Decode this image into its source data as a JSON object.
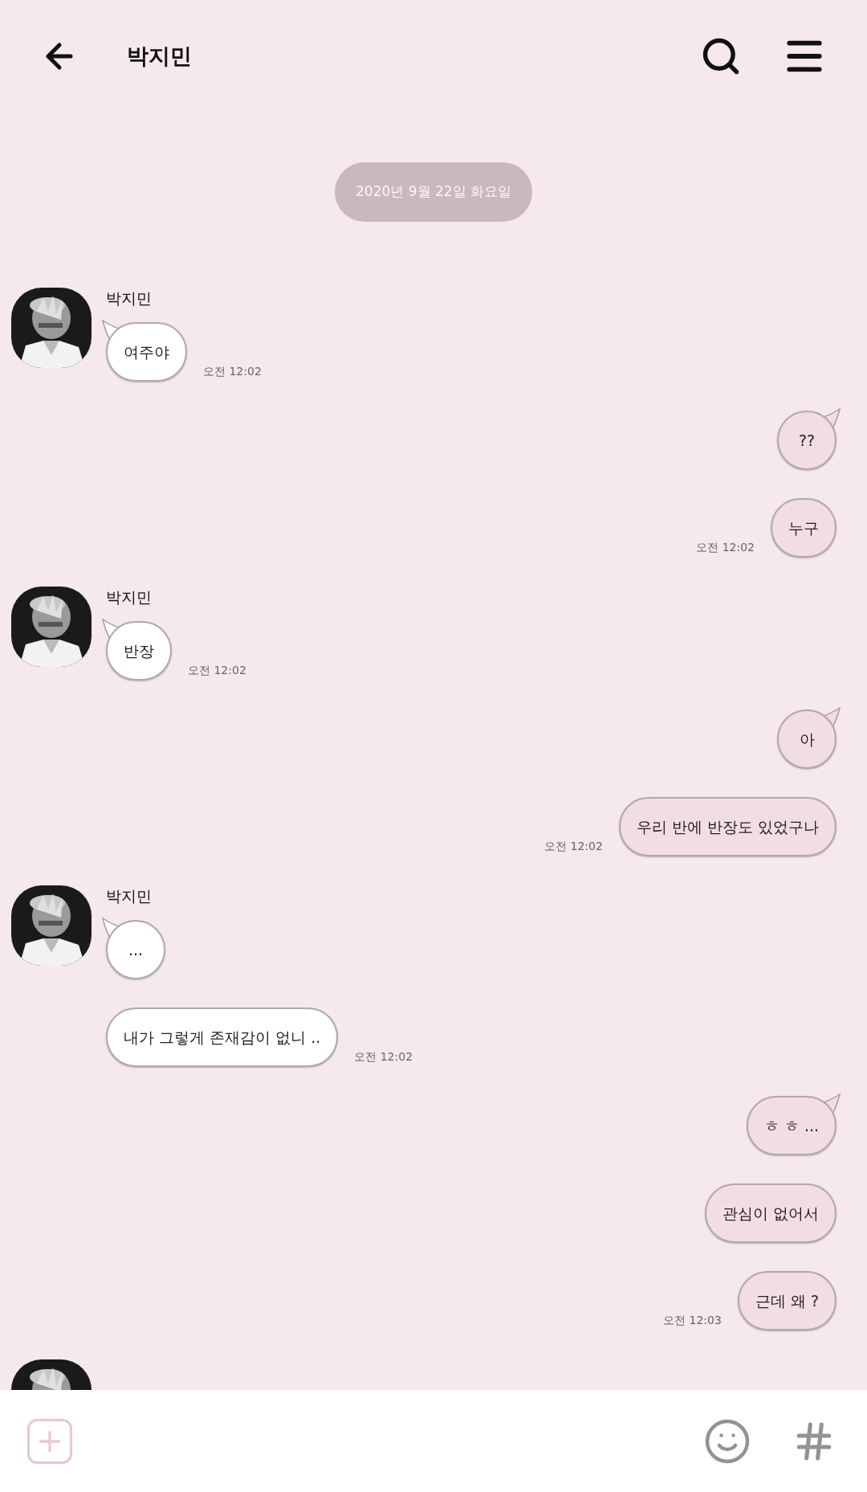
{
  "header": {
    "title": "박지민"
  },
  "date_divider": "2020년 9월 22일 화요일",
  "groups": [
    {
      "kind": "incoming",
      "sender": "박지민",
      "messages": [
        "여주야"
      ],
      "time": "오전 12:02"
    },
    {
      "kind": "outgoing",
      "messages": [
        "??",
        "누구"
      ],
      "time": "오전 12:02"
    },
    {
      "kind": "incoming",
      "sender": "박지민",
      "messages": [
        "반장"
      ],
      "time": "오전 12:02"
    },
    {
      "kind": "outgoing",
      "messages": [
        "아",
        "우리 반에 반장도 있었구나"
      ],
      "time": "오전 12:02"
    },
    {
      "kind": "incoming",
      "sender": "박지민",
      "messages": [
        "...",
        "내가 그렇게 존재감이 없니 .."
      ],
      "time": "오전 12:02"
    },
    {
      "kind": "outgoing",
      "messages": [
        "ㅎ ㅎ ...",
        "관심이 없어서",
        "근데 왜 ?"
      ],
      "time": "오전 12:03"
    }
  ]
}
